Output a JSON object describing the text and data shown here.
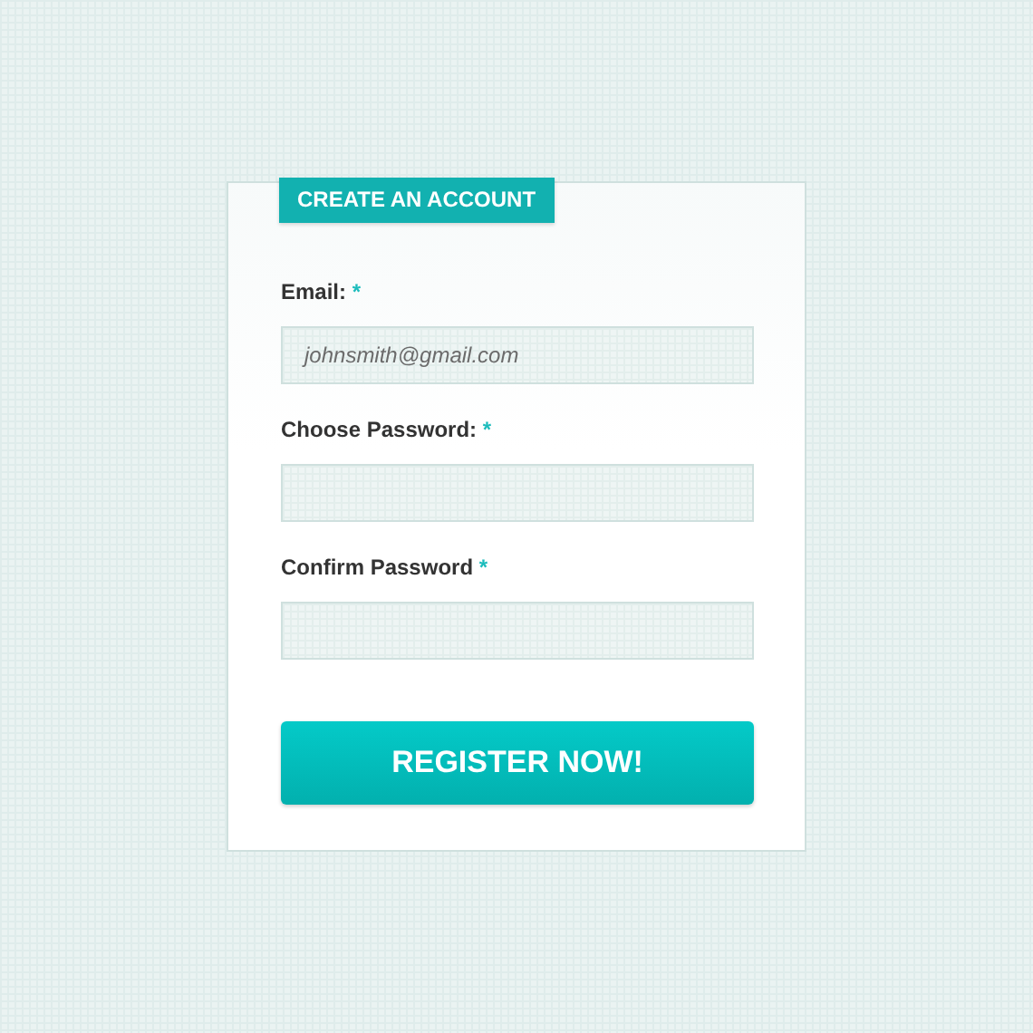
{
  "form": {
    "title": "CREATE AN ACCOUNT",
    "fields": [
      {
        "label": "Email:",
        "required_mark": "*",
        "placeholder": "johnsmith@gmail.com"
      },
      {
        "label": "Choose Password:",
        "required_mark": "*"
      },
      {
        "label": "Confirm Password",
        "required_mark": "*"
      }
    ],
    "submit": "REGISTER NOW!"
  }
}
